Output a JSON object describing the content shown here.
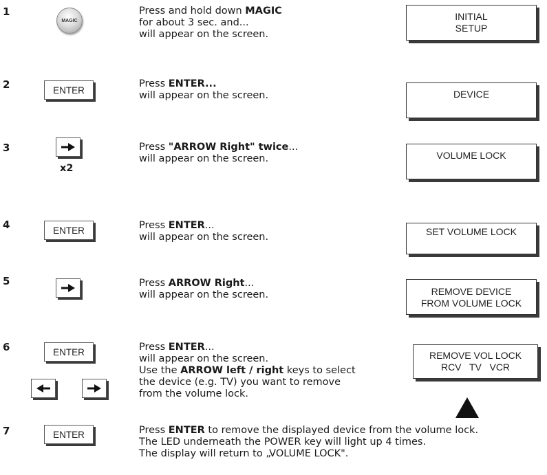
{
  "steps": [
    {
      "number": "1",
      "button": "MAGIC",
      "pre": "Press and hold down ",
      "bold": "MAGIC",
      "post": "",
      "line2": "for about 3 sec. and...",
      "line3": "will appear on the screen.",
      "display": [
        "INITIAL",
        "SETUP"
      ]
    },
    {
      "number": "2",
      "button": "ENTER",
      "pre": "Press ",
      "bold": "ENTER...",
      "post": "",
      "line2": "will appear on the screen.",
      "display": [
        "DEVICE"
      ]
    },
    {
      "number": "3",
      "button": "ARROW Right",
      "multiplier": "x2",
      "pre": "Press ",
      "bold": "\"ARROW Right\" twice",
      "post": "...",
      "line2": "will appear on the screen.",
      "display": [
        "VOLUME LOCK"
      ]
    },
    {
      "number": "4",
      "button": "ENTER",
      "pre": "Press ",
      "bold": "ENTER",
      "post": "...",
      "line2": "will appear on the screen.",
      "display": [
        "SET VOLUME LOCK"
      ]
    },
    {
      "number": "5",
      "button": "ARROW Right",
      "pre": "Press ",
      "bold": "ARROW Right",
      "post": "...",
      "line2": "will appear on the screen.",
      "display": [
        "REMOVE DEVICE",
        "FROM VOLUME LOCK"
      ]
    },
    {
      "number": "6",
      "button": "ENTER",
      "pre": "Press ",
      "bold": "ENTER",
      "post": "...",
      "line2": "will appear on the screen.",
      "line3_pre": "Use the ",
      "line3_bold": "ARROW left / right",
      "line3_post": " keys to select",
      "line4": "the device (e.g. TV)  you want to remove",
      "line5": "from the volume lock.",
      "display": [
        "REMOVE VOL LOCK",
        "RCV   TV   VCR"
      ]
    },
    {
      "number": "7",
      "button": "ENTER",
      "pre": "Press ",
      "bold": "ENTER",
      "post": " to remove the displayed device from the volume lock.",
      "line2": "The LED underneath the POWER key will light up 4 times.",
      "line3": "The display will return to „VOLUME LOCK\"."
    }
  ],
  "icons": {
    "arrow_right": "arrow-right-icon",
    "arrow_left": "arrow-left-icon",
    "pointer": "triangle-up-icon"
  }
}
